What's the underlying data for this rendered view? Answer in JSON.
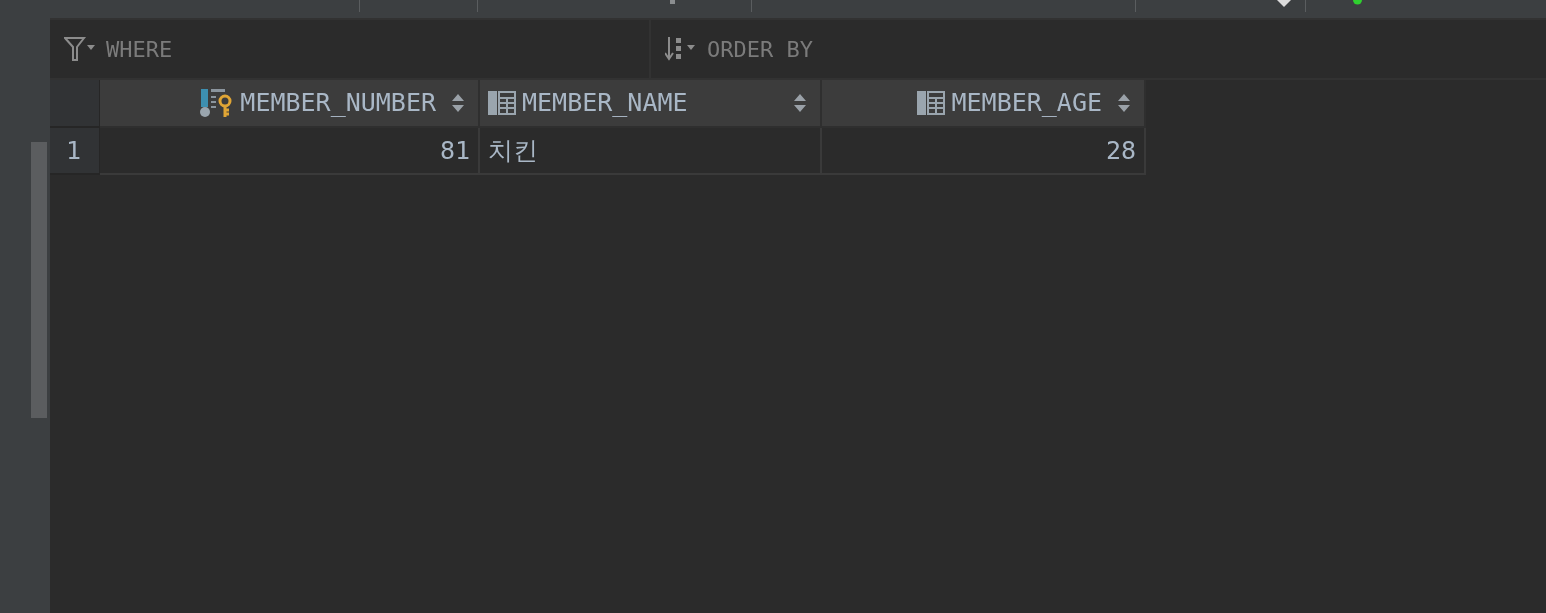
{
  "filter_bar": {
    "where_placeholder": "WHERE",
    "order_by_placeholder": "ORDER BY"
  },
  "table": {
    "columns": [
      {
        "label": "MEMBER_NUMBER",
        "kind": "primary_key",
        "numeric": true
      },
      {
        "label": "MEMBER_NAME",
        "kind": "column",
        "numeric": false
      },
      {
        "label": "MEMBER_AGE",
        "kind": "column",
        "numeric": true
      }
    ],
    "rows": [
      {
        "number": "1",
        "cells": [
          "81",
          "치킨",
          "28"
        ]
      }
    ]
  }
}
